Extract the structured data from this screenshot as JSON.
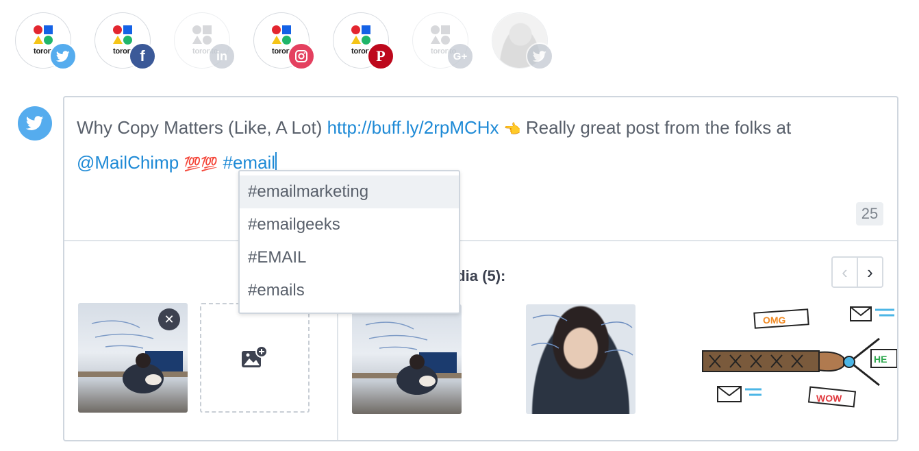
{
  "accounts": [
    {
      "name": "toronto",
      "network": "twitter",
      "icon": "twitter-icon",
      "badge_color": "#55acee",
      "dimmed": false
    },
    {
      "name": "toronto",
      "network": "facebook",
      "icon": "facebook-icon",
      "badge_color": "#3b5998",
      "dimmed": false
    },
    {
      "name": "toronto",
      "network": "linkedin",
      "icon": "linkedin-icon",
      "badge_color": "#bfc6cf",
      "dimmed": true
    },
    {
      "name": "toronto",
      "network": "instagram",
      "icon": "instagram-icon",
      "badge_color": "#e4405f",
      "dimmed": false
    },
    {
      "name": "toronto",
      "network": "pinterest",
      "icon": "pinterest-icon",
      "badge_color": "#bd081c",
      "dimmed": false
    },
    {
      "name": "toronto",
      "network": "google-plus",
      "icon": "google-plus-icon",
      "badge_color": "#bfc6cf",
      "dimmed": true
    },
    {
      "name": "",
      "network": "twitter",
      "icon": "twitter-icon",
      "badge_color": "#bfc6cf",
      "dimmed": true
    }
  ],
  "composer": {
    "network_icon": "twitter-icon",
    "text_parts": {
      "plain_1": "Why Copy Matters (Like, A Lot) ",
      "link": "http://buff.ly/2rpMCHx",
      "emoji_point": "👈",
      "plain_2": " Really great post from the folks at ",
      "mention": "@MailChimp",
      "emoji_100": "💯💯",
      "hashtag": "#email"
    },
    "char_count": "25",
    "suggested_label": "edia (5):"
  },
  "hashtag_suggestions": [
    "#emailmarketing",
    "#emailgeeks",
    "#EMAIL",
    "#emails"
  ],
  "colors": {
    "twitter": "#55acee",
    "link": "#1e8ad6",
    "border": "#cfd6de"
  }
}
